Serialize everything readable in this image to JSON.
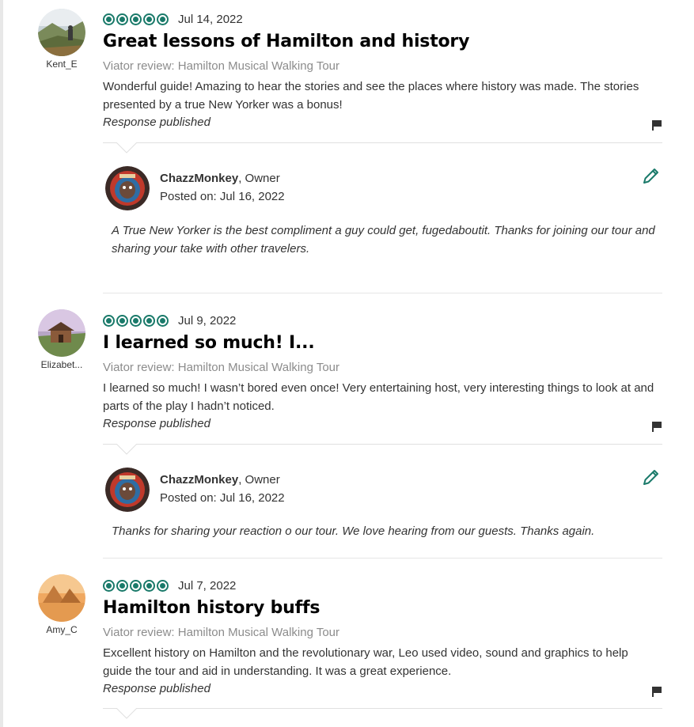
{
  "colors": {
    "bubble": "#1a7a6a",
    "accent": "#00aa6c",
    "muted": "#8c8c8c"
  },
  "reviews": [
    {
      "username": "Kent_E",
      "rating": 5,
      "date": "Jul 14, 2022",
      "title": "Great lessons of Hamilton and history",
      "source": "Viator review: Hamilton Musical Walking Tour",
      "body": "Wonderful guide! Amazing to hear the stories and see the places where history was made. The stories presented by a true New Yorker was a bonus!",
      "response_status": "Response published",
      "reply": {
        "owner_name": "ChazzMonkey",
        "owner_role": ", Owner",
        "posted_label": "Posted on: Jul 16, 2022",
        "text_line1": "A True New Yorker is the best compliment a guy could get, fugedaboutit. Thanks for joining our tour and",
        "text_line2": "sharing your take with other travelers."
      }
    },
    {
      "username": "Elizabet...",
      "rating": 5,
      "date": "Jul 9, 2022",
      "title": "I learned so much! I...",
      "source": "Viator review: Hamilton Musical Walking Tour",
      "body": "I learned so much! I wasn’t bored even once! Very entertaining host, very interesting things to look at and parts of the play I hadn’t noticed.",
      "response_status": "Response published",
      "reply": {
        "owner_name": "ChazzMonkey",
        "owner_role": ", Owner",
        "posted_label": "Posted on: Jul 16, 2022",
        "text_line1": "Thanks for sharing your reaction o our tour. We love hearing from our guests. Thanks again."
      }
    },
    {
      "username": "Amy_C",
      "rating": 5,
      "date": "Jul 7, 2022",
      "title": "Hamilton history buffs",
      "source": "Viator review: Hamilton Musical Walking Tour",
      "body": "Excellent history on Hamilton and the revolutionary war, Leo used video, sound and graphics to help guide the tour and aid in understanding. It was a great experience.",
      "response_status": "Response published"
    }
  ],
  "icons": {
    "flag": "flag-icon",
    "edit": "pencil-icon",
    "rating": "bubble-rating-icon"
  }
}
